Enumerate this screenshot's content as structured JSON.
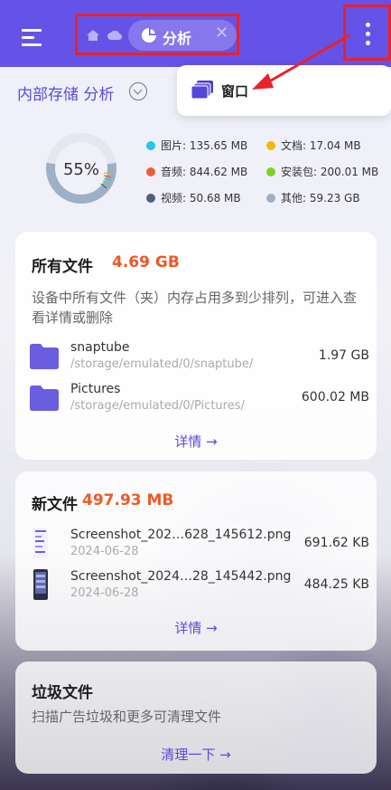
{
  "topbar": {
    "crumb_label": "分析",
    "close_symbol": "✕",
    "accent": "#6553e7",
    "highlight": "#e8222a"
  },
  "subheader": {
    "title": "内部存储 分析"
  },
  "menu_popup": {
    "window_label": "窗口"
  },
  "storage": {
    "used_percent": "55%",
    "used_fraction": 0.55,
    "categories": [
      {
        "label": "图片: 135.65 MB",
        "color": "#25c6e8"
      },
      {
        "label": "文档: 17.04 MB",
        "color": "#f5b800"
      },
      {
        "label": "音频: 844.62 MB",
        "color": "#f05a3c"
      },
      {
        "label": "安装包: 200.01 MB",
        "color": "#7ad320"
      },
      {
        "label": "视频: 50.68 MB",
        "color": "#4f6275"
      },
      {
        "label": "其他: 59.23 GB",
        "color": "#9db0c6"
      }
    ]
  },
  "all_files": {
    "title": "所有文件",
    "size": "4.69 GB",
    "description": "设备中所有文件（夹）内存占用多到少排列，可进入查看详情或删除",
    "items": [
      {
        "name": "snaptube",
        "path": "/storage/emulated/0/snaptube/",
        "size": "1.97 GB"
      },
      {
        "name": "Pictures",
        "path": "/storage/emulated/0/Pictures/",
        "size": "600.02 MB"
      }
    ],
    "link": "详情 →"
  },
  "new_files": {
    "title": "新文件",
    "size": "497.93 MB",
    "items": [
      {
        "name": "Screenshot_202…628_145612.png",
        "date": "2024-06-28",
        "size": "691.62 KB"
      },
      {
        "name": "Screenshot_2024…28_145442.png",
        "date": "2024-06-28",
        "size": "484.25 KB"
      }
    ],
    "link": "详情 →"
  },
  "junk": {
    "title": "垃圾文件",
    "description": "扫描广告垃圾和更多可清理文件",
    "link": "清理一下 →"
  }
}
